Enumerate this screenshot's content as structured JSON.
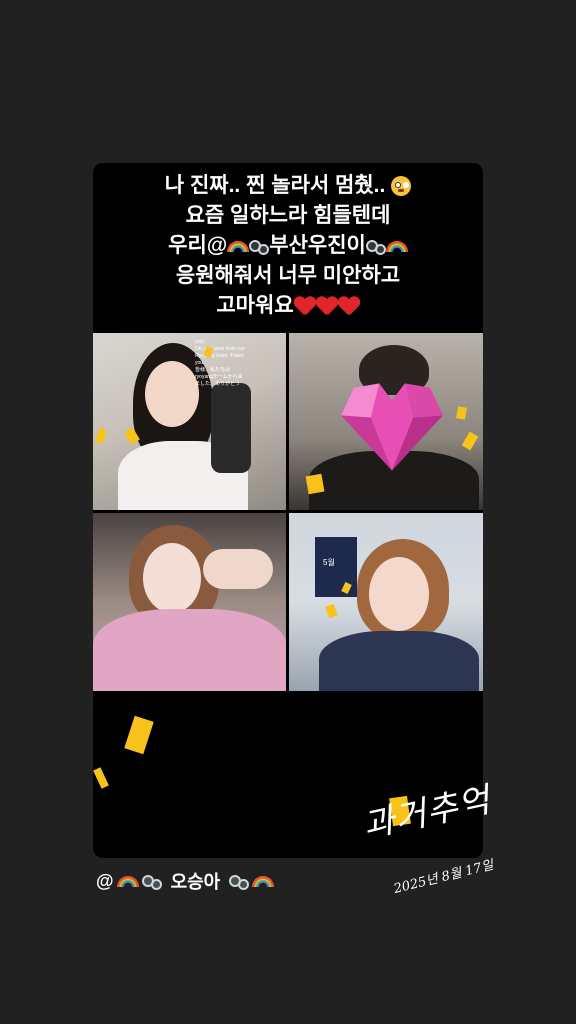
{
  "story": {
    "caption_lines": [
      "나 진짜.. 찐 놀라서 멈췄..",
      "요즘 일하느라 힘들텐데",
      "우리@",
      "부산우진이",
      "응원해줘서 너무 미안하고",
      "고마워요"
    ],
    "icons": {
      "flushed": "flushed-face-icon",
      "rainbow": "rainbow-icon",
      "bubbles": "bubbles-icon",
      "heart": "red-heart-icon",
      "mask": "pink-heart-mask-icon"
    }
  },
  "video_grid": {
    "subtitle_overlay": [
      "(ab)",
      "Oh, we came from our",
      "Ryoyang team. Thank",
      "you.",
      "皆様、私たちは",
      "ryoyangチームから来",
      "ました。ありがとう"
    ],
    "tile4_sign": "5월"
  },
  "user_tag": {
    "prefix": "@",
    "name": "오승아"
  },
  "overlay": {
    "script_title": "과거추억",
    "script_date": "2025년 8월 17일"
  },
  "colors": {
    "background": "#212121",
    "card": "#000000",
    "confetti": "#f7c21a",
    "heart": "#e0262b",
    "mask": "#e84fb5"
  }
}
